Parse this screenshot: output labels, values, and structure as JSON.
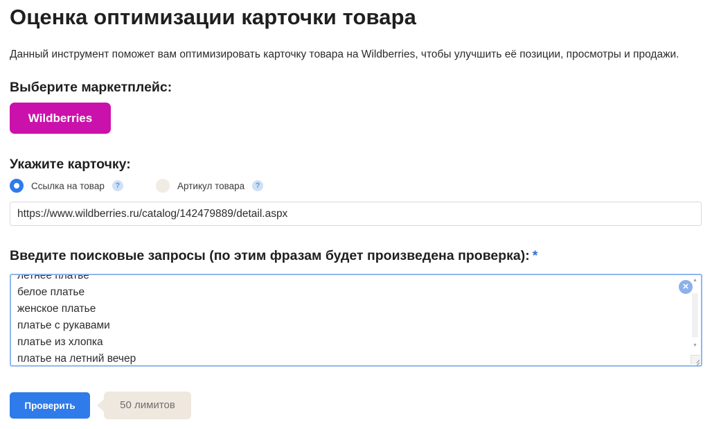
{
  "page": {
    "title": "Оценка оптимизации карточки товара",
    "intro": "Данный инструмент поможет вам оптимизировать карточку товара на Wildberries, чтобы улучшить её позиции, просмотры и продажи."
  },
  "marketplace": {
    "heading": "Выберите маркетплейс:",
    "button_label": "Wildberries",
    "button_color": "#cb11ab"
  },
  "card": {
    "heading": "Укажите карточку:",
    "options": [
      {
        "label": "Ссылка на товар",
        "selected": true,
        "help_icon": "question-icon"
      },
      {
        "label": "Артикул товара",
        "selected": false,
        "help_icon": "question-icon"
      }
    ],
    "url_value": "https://www.wildberries.ru/catalog/142479889/detail.aspx"
  },
  "queries": {
    "heading": "Введите поисковые запросы (по этим фразам будет произведена проверка):",
    "required_mark": "*",
    "lines": [
      "летнее платье",
      "белое платье",
      "женское платье",
      "платье с рукавами",
      "платье из хлопка",
      "платье на летний вечер"
    ],
    "clear_icon": "close-circle-icon"
  },
  "actions": {
    "submit_label": "Проверить",
    "limits_label": "50 лимитов",
    "accent_color": "#2f7be9"
  }
}
